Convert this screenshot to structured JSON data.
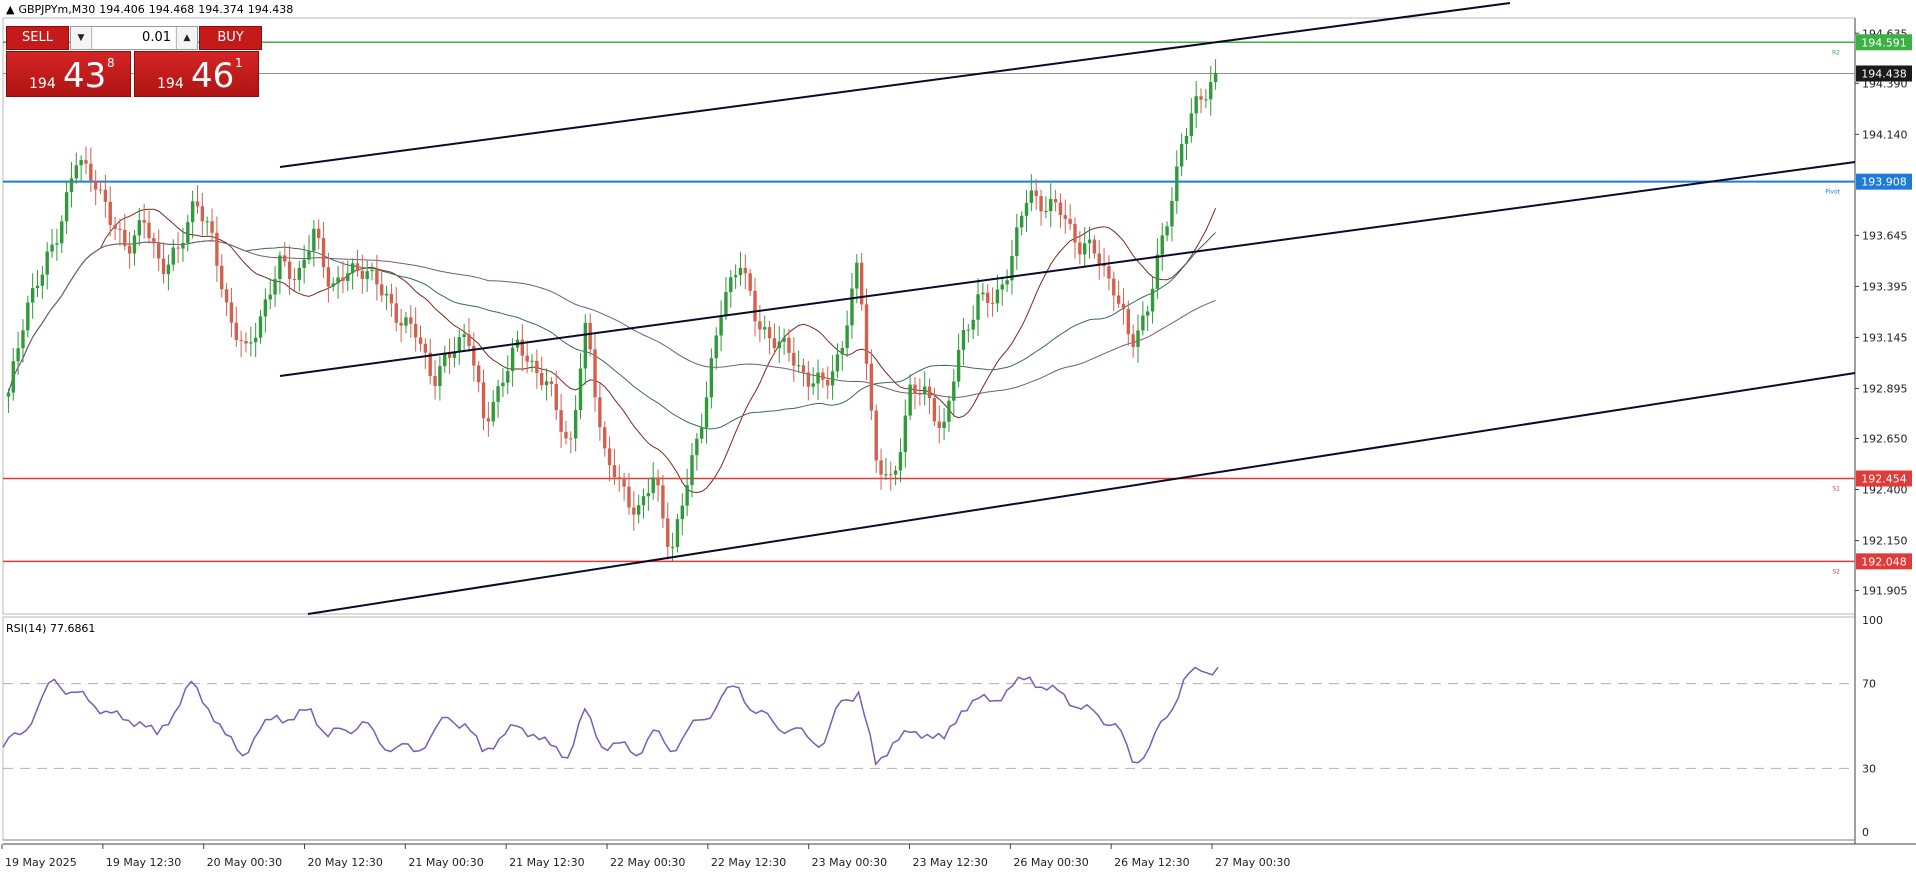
{
  "header": {
    "symbol": "GBPJPYm,M30",
    "ohlc": [
      "194.406",
      "194.468",
      "194.374",
      "194.438"
    ]
  },
  "trade_panel": {
    "sell_label": "SELL",
    "buy_label": "BUY",
    "lot": "0.01",
    "sell_price": {
      "prefix": "194",
      "big": "43",
      "sup": "8"
    },
    "buy_price": {
      "prefix": "194",
      "big": "46",
      "sup": "1"
    }
  },
  "colors": {
    "bull": "#2f9a3a",
    "bear": "#d2604e",
    "r2": "#3cb043",
    "pivot": "#1e7bd8",
    "support": "#e03a3a",
    "trend": "#0a0a2a",
    "rsi": "#7a5bb8"
  },
  "chart_data": [
    {
      "type": "line",
      "title": "GBPJPYm,M30",
      "ylim": [
        191.8,
        194.7
      ],
      "y_ticks": [
        "194.635",
        "194.390",
        "194.140",
        "193.645",
        "193.395",
        "193.145",
        "192.895",
        "192.650",
        "192.400",
        "192.150",
        "191.905"
      ],
      "x_ticks": [
        "19 May 2025",
        "19 May 12:30",
        "20 May 00:30",
        "20 May 12:30",
        "21 May 00:30",
        "21 May 12:30",
        "22 May 00:30",
        "22 May 12:30",
        "23 May 00:30",
        "23 May 12:30",
        "26 May 00:30",
        "26 May 12:30",
        "27 May 00:30"
      ],
      "price_line": {
        "value": 194.438,
        "label": "194.438"
      },
      "levels": [
        {
          "name": "R2",
          "value": 194.591,
          "label": "194.591",
          "tag": "R2"
        },
        {
          "name": "Pivot",
          "value": 193.908,
          "label": "193.908",
          "tag": "Pivot"
        },
        {
          "name": "S1",
          "value": 192.454,
          "label": "192.454",
          "tag": "S1"
        },
        {
          "name": "S2",
          "value": 192.048,
          "label": "192.048",
          "tag": "S2"
        }
      ],
      "close_path": [
        192.85,
        193.3,
        193.45,
        193.7,
        194.0,
        193.95,
        193.7,
        193.6,
        193.7,
        193.5,
        193.55,
        193.85,
        193.6,
        193.25,
        193.05,
        193.3,
        193.5,
        193.45,
        193.65,
        193.4,
        193.45,
        193.5,
        193.35,
        193.25,
        193.15,
        192.95,
        193.05,
        193.2,
        192.7,
        192.95,
        193.1,
        193.0,
        192.85,
        192.6,
        193.2,
        192.6,
        192.4,
        192.3,
        192.45,
        192.1,
        192.45,
        192.85,
        193.3,
        193.55,
        193.2,
        193.15,
        193.05,
        192.95,
        192.9,
        193.1,
        193.5,
        192.55,
        192.4,
        192.9,
        192.85,
        192.7,
        193.1,
        193.35,
        193.3,
        193.55,
        193.85,
        193.8,
        193.75,
        193.6,
        193.55,
        193.4,
        193.1,
        193.3,
        193.65,
        194.1,
        194.3,
        194.44
      ]
    },
    {
      "type": "line",
      "title": "RSI(14) 77.6861",
      "ylim": [
        0,
        100
      ],
      "y_ticks": [
        "100",
        "70",
        "30",
        "0"
      ],
      "levels": [
        70,
        30
      ],
      "values": [
        40,
        46,
        58,
        72,
        66,
        62,
        57,
        53,
        52,
        46,
        56,
        71,
        58,
        46,
        36,
        48,
        55,
        53,
        58,
        45,
        48,
        52,
        42,
        40,
        38,
        45,
        54,
        51,
        38,
        44,
        50,
        46,
        41,
        35,
        58,
        40,
        42,
        36,
        48,
        38,
        48,
        53,
        64,
        68,
        56,
        52,
        48,
        45,
        42,
        62,
        66,
        32,
        42,
        47,
        46,
        44,
        57,
        63,
        62,
        69,
        73,
        67,
        65,
        58,
        55,
        51,
        33,
        40,
        54,
        72,
        76,
        77.7
      ]
    }
  ]
}
